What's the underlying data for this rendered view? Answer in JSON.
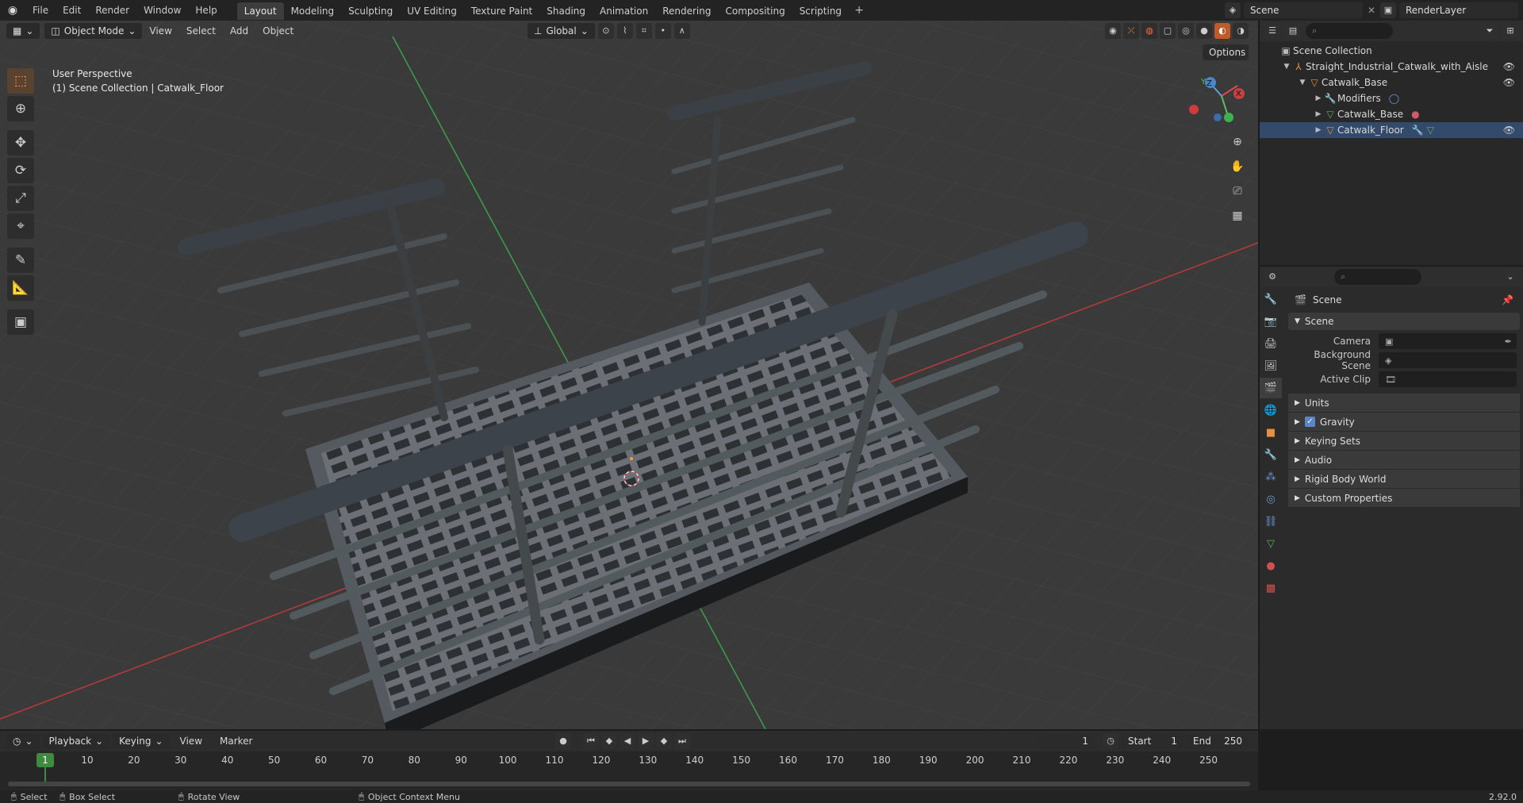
{
  "topbar": {
    "menus": [
      "File",
      "Edit",
      "Render",
      "Window",
      "Help"
    ],
    "workspaces": [
      "Layout",
      "Modeling",
      "Sculpting",
      "UV Editing",
      "Texture Paint",
      "Shading",
      "Animation",
      "Rendering",
      "Compositing",
      "Scripting"
    ],
    "active_workspace": "Layout",
    "add_tab": "+",
    "scene_name": "Scene",
    "view_layer": "RenderLayer"
  },
  "viewport": {
    "mode": "Object Mode",
    "menus": [
      "View",
      "Select",
      "Add",
      "Object"
    ],
    "orientation": "Global",
    "options_label": "Options",
    "view_name": "User Perspective",
    "context": "(1) Scene Collection | Catwalk_Floor",
    "gizmo": {
      "x": "X",
      "y": "Y",
      "z": "Z"
    }
  },
  "outliner": {
    "root": "Scene Collection",
    "items": [
      {
        "label": "Straight_Industrial_Catwalk_with_Aisle",
        "level": 1
      },
      {
        "label": "Catwalk_Base",
        "level": 2
      },
      {
        "label": "Modifiers",
        "level": 3
      },
      {
        "label": "Catwalk_Base",
        "level": 3
      },
      {
        "label": "Catwalk_Floor",
        "level": 3
      }
    ]
  },
  "properties": {
    "context": "Scene",
    "panel_title": "Scene",
    "fields": [
      {
        "label": "Camera"
      },
      {
        "label": "Background Scene"
      },
      {
        "label": "Active Clip"
      }
    ],
    "subpanels": [
      "Units",
      "Gravity",
      "Keying Sets",
      "Audio",
      "Rigid Body World",
      "Custom Properties"
    ],
    "gravity_checked": true
  },
  "timeline": {
    "menus": [
      "Playback",
      "Keying",
      "View",
      "Marker"
    ],
    "current_frame": "1",
    "start_label": "Start",
    "start": "1",
    "end_label": "End",
    "end": "250",
    "ruler": [
      "1",
      "10",
      "20",
      "30",
      "40",
      "50",
      "60",
      "70",
      "80",
      "90",
      "100",
      "110",
      "120",
      "130",
      "140",
      "150",
      "160",
      "170",
      "180",
      "190",
      "200",
      "210",
      "220",
      "230",
      "240",
      "250"
    ]
  },
  "statusbar": {
    "select": "Select",
    "box_select": "Box Select",
    "rotate": "Rotate View",
    "context_menu": "Object Context Menu",
    "version": "2.92.0"
  },
  "colors": {
    "accent": "#ff8c3a",
    "grid_x": "#b83a3a",
    "grid_y": "#3aa04a",
    "frame_current": "#3e8a3e"
  }
}
